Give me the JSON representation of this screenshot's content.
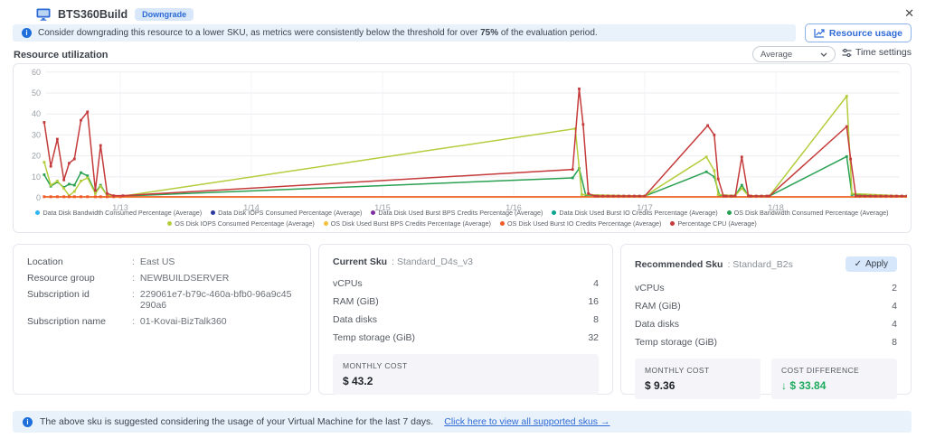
{
  "window": {
    "title": "BTS360Build",
    "badge": "Downgrade"
  },
  "icons": {
    "close": "✕",
    "check": "✓",
    "down_arrow": "↓",
    "info": "i"
  },
  "colors": {
    "accent": "#2e6bd6",
    "banner_bg": "#e9f1fb",
    "savings_green": "#1fab5e",
    "badge_bg": "#d8e7fa"
  },
  "alert_top": {
    "text_before": "Consider downgrading this resource to a lower SKU, as metrics were consistently below the threshold for over ",
    "bold": "75%",
    "text_after": " of the evaluation period."
  },
  "toolbar": {
    "resource_usage": "Resource usage",
    "average": "Average",
    "time_settings": "Time settings"
  },
  "section_title": "Resource utilization",
  "chart_data": {
    "type": "line",
    "title": "Resource utilization",
    "x_axis": {
      "labels": [
        "1/13",
        "1/14",
        "1/15",
        "1/16",
        "1/17",
        "1/18"
      ],
      "unit": "day (x values below are fractional days of January)"
    },
    "y_axis": {
      "min": 0,
      "max": 60,
      "ticks": [
        0,
        10,
        20,
        30,
        40,
        50,
        60
      ],
      "unit": "percent"
    },
    "grid": true,
    "legend_position": "bottom",
    "series": [
      {
        "name": "Data Disk Bandwidth Consumed Percentage (Average)",
        "color": "#30b4f2",
        "points": [
          [
            12.42,
            0.3
          ],
          [
            19.0,
            0.3
          ]
        ]
      },
      {
        "name": "Data Disk IOPS Consumed Percentage (Average)",
        "color": "#2d3a9e",
        "points": [
          [
            12.42,
            0.3
          ],
          [
            19.0,
            0.3
          ]
        ]
      },
      {
        "name": "Data Disk Used Burst BPS Credits Percentage (Average)",
        "color": "#8030a0",
        "points": [
          [
            12.42,
            0.3
          ],
          [
            19.0,
            0.3
          ]
        ]
      },
      {
        "name": "Data Disk Used Burst IO Credits Percentage (Average)",
        "color": "#0aa58e",
        "points": [
          [
            12.42,
            0.3
          ],
          [
            19.0,
            0.3
          ]
        ]
      },
      {
        "name": "OS Disk Bandwidth Consumed Percentage (Average)",
        "color": "#2aa052",
        "markers": true,
        "points": [
          [
            12.42,
            11
          ],
          [
            12.47,
            5.5
          ],
          [
            12.52,
            7.5
          ],
          [
            12.57,
            5
          ],
          [
            12.61,
            6.5
          ],
          [
            12.65,
            6
          ],
          [
            12.7,
            12
          ],
          [
            12.75,
            10.5
          ],
          [
            12.81,
            2.5
          ],
          [
            12.85,
            6
          ],
          [
            12.9,
            1
          ],
          [
            13.02,
            0.8
          ],
          [
            16.45,
            9.5
          ],
          [
            16.5,
            14
          ],
          [
            16.55,
            1.2
          ],
          [
            17.0,
            0.8
          ],
          [
            17.47,
            12.4
          ],
          [
            17.53,
            10
          ],
          [
            17.57,
            1.2
          ],
          [
            17.69,
            1
          ],
          [
            17.74,
            6
          ],
          [
            17.79,
            1
          ],
          [
            17.95,
            0.8
          ],
          [
            18.54,
            19.7
          ],
          [
            18.58,
            1.5
          ],
          [
            19.0,
            0.8
          ]
        ]
      },
      {
        "name": "OS Disk IOPS Consumed Percentage (Average)",
        "color": "#b4cd3c",
        "markers": true,
        "points": [
          [
            12.42,
            17
          ],
          [
            12.47,
            6
          ],
          [
            12.52,
            8
          ],
          [
            12.57,
            4.5
          ],
          [
            12.61,
            1
          ],
          [
            12.65,
            3
          ],
          [
            12.7,
            8
          ],
          [
            12.75,
            9.5
          ],
          [
            12.81,
            2
          ],
          [
            12.85,
            5.5
          ],
          [
            12.9,
            1
          ],
          [
            13.02,
            0.8
          ],
          [
            16.47,
            33
          ],
          [
            16.52,
            1.5
          ],
          [
            17.0,
            0.8
          ],
          [
            17.47,
            19.5
          ],
          [
            17.53,
            13
          ],
          [
            17.56,
            1.5
          ],
          [
            17.69,
            1
          ],
          [
            17.74,
            4.5
          ],
          [
            17.79,
            1
          ],
          [
            17.95,
            0.8
          ],
          [
            18.54,
            48.5
          ],
          [
            18.58,
            2
          ],
          [
            19.0,
            0.8
          ]
        ]
      },
      {
        "name": "OS Disk Used Burst BPS Credits Percentage (Average)",
        "color": "#f4c13d",
        "points": [
          [
            12.42,
            0.3
          ],
          [
            19.0,
            0.3
          ]
        ]
      },
      {
        "name": "OS Disk Used Burst IO Credits Percentage (Average)",
        "color": "#ef5a28",
        "points": [
          [
            12.42,
            0.5
          ],
          [
            19.0,
            0.5
          ]
        ],
        "dots": [
          [
            12.42,
            0.5
          ],
          [
            12.47,
            0.5
          ],
          [
            12.52,
            0.5
          ],
          [
            12.57,
            0.5
          ],
          [
            12.61,
            0.5
          ],
          [
            12.65,
            0.5
          ],
          [
            12.7,
            0.5
          ],
          [
            12.75,
            0.5
          ],
          [
            12.81,
            0.5
          ],
          [
            12.85,
            0.5
          ],
          [
            12.9,
            0.5
          ],
          [
            12.95,
            0.5
          ],
          [
            13.0,
            0.5
          ]
        ]
      },
      {
        "name": "Percentage CPU (Average)",
        "color": "#c53b3b",
        "markers": true,
        "points": [
          [
            12.42,
            36
          ],
          [
            12.47,
            15
          ],
          [
            12.52,
            28
          ],
          [
            12.57,
            8.5
          ],
          [
            12.61,
            16.5
          ],
          [
            12.65,
            18.5
          ],
          [
            12.7,
            37
          ],
          [
            12.75,
            41
          ],
          [
            12.81,
            3.5
          ],
          [
            12.85,
            25
          ],
          [
            12.9,
            2
          ],
          [
            12.95,
            1
          ],
          [
            13.02,
            1
          ],
          [
            16.45,
            13.5
          ],
          [
            16.5,
            52
          ],
          [
            16.53,
            35
          ],
          [
            16.57,
            2
          ],
          [
            16.62,
            0.8
          ],
          [
            17.0,
            0.8
          ],
          [
            17.48,
            34.5
          ],
          [
            17.53,
            30
          ],
          [
            17.56,
            9
          ],
          [
            17.6,
            0.8
          ],
          [
            17.69,
            0.8
          ],
          [
            17.74,
            19.5
          ],
          [
            17.79,
            0.8
          ],
          [
            17.95,
            0.8
          ],
          [
            18.54,
            34
          ],
          [
            18.57,
            18.5
          ],
          [
            18.61,
            0.8
          ],
          [
            19.0,
            0.8
          ]
        ],
        "dots": [
          [
            16.64,
            0.8
          ],
          [
            16.68,
            0.8
          ],
          [
            16.72,
            0.8
          ],
          [
            16.76,
            0.8
          ],
          [
            16.8,
            0.8
          ],
          [
            16.84,
            0.8
          ],
          [
            16.88,
            0.8
          ],
          [
            16.92,
            0.8
          ],
          [
            16.96,
            0.8
          ],
          [
            17.62,
            0.8
          ],
          [
            17.66,
            0.8
          ],
          [
            17.81,
            0.8
          ],
          [
            17.85,
            0.8
          ],
          [
            17.89,
            0.8
          ],
          [
            17.93,
            0.8
          ],
          [
            18.64,
            0.8
          ],
          [
            18.68,
            0.8
          ],
          [
            18.72,
            0.8
          ],
          [
            18.76,
            0.8
          ],
          [
            18.8,
            0.8
          ],
          [
            18.84,
            0.8
          ],
          [
            18.88,
            0.8
          ],
          [
            18.92,
            0.8
          ],
          [
            18.96,
            0.8
          ]
        ]
      }
    ]
  },
  "details": {
    "rows": [
      {
        "label": "Location",
        "value": "East US"
      },
      {
        "label": "Resource group",
        "value": "NEWBUILDSERVER"
      },
      {
        "label": "Subscription id",
        "value": "229061e7-b79c-460a-bfb0-96a9c45290a6"
      },
      {
        "label": "Subscription name",
        "value": "01-Kovai-BizTalk360"
      }
    ]
  },
  "current_sku": {
    "title": "Current Sku",
    "name": "Standard_D4s_v3",
    "specs": [
      {
        "label": "vCPUs",
        "value": "4"
      },
      {
        "label": "RAM (GiB)",
        "value": "16"
      },
      {
        "label": "Data disks",
        "value": "8"
      },
      {
        "label": "Temp storage (GiB)",
        "value": "32"
      }
    ],
    "monthly_cost": {
      "label": "MONTHLY COST",
      "value": "$ 43.2"
    }
  },
  "recommended_sku": {
    "title": "Recommended Sku",
    "name": "Standard_B2s",
    "apply_label": "Apply",
    "specs": [
      {
        "label": "vCPUs",
        "value": "2"
      },
      {
        "label": "RAM (GiB)",
        "value": "4"
      },
      {
        "label": "Data disks",
        "value": "4"
      },
      {
        "label": "Temp storage (GiB)",
        "value": "8"
      }
    ],
    "monthly_cost": {
      "label": "MONTHLY COST",
      "value": "$ 9.36"
    },
    "cost_difference": {
      "label": "COST DIFFERENCE",
      "value": "$ 33.84"
    }
  },
  "footer": {
    "text": "The above sku is suggested considering the usage of your Virtual Machine for the last 7 days.",
    "link": "Click here to view all supported skus →"
  }
}
